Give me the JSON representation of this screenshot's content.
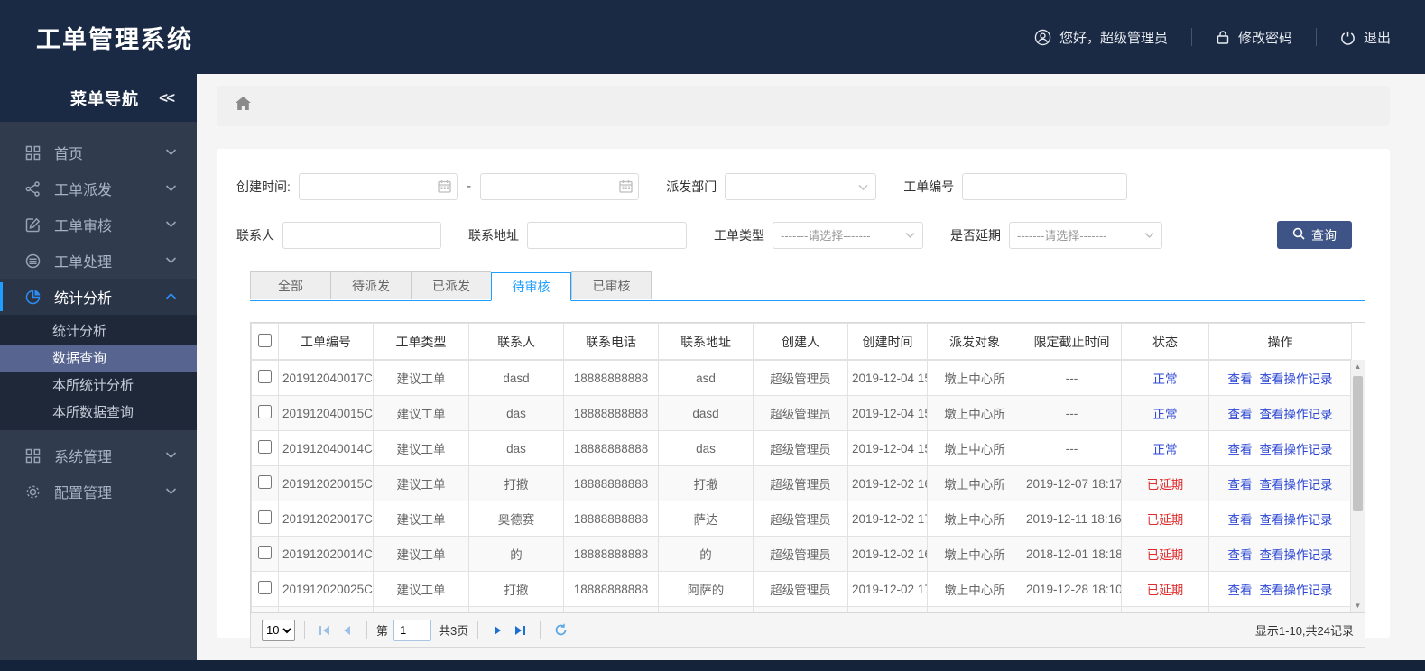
{
  "app": {
    "title": "工单管理系统"
  },
  "topbar": {
    "greeting": "您好，超级管理员",
    "change_password": "修改密码",
    "logout": "退出"
  },
  "sidebar": {
    "title": "菜单导航",
    "collapse_glyph": "<<",
    "items": [
      {
        "label": "首页"
      },
      {
        "label": "工单派发"
      },
      {
        "label": "工单审核"
      },
      {
        "label": "工单处理"
      },
      {
        "label": "统计分析"
      },
      {
        "label": "系统管理"
      },
      {
        "label": "配置管理"
      }
    ],
    "submenu": [
      {
        "label": "统计分析"
      },
      {
        "label": "数据查询"
      },
      {
        "label": "本所统计分析"
      },
      {
        "label": "本所数据查询"
      }
    ]
  },
  "filters": {
    "create_time_label": "创建时间:",
    "date_separator": "-",
    "depart_label": "派发部门",
    "order_no_label": "工单编号",
    "contact_label": "联系人",
    "address_label": "联系地址",
    "order_type_label": "工单类型",
    "order_type_value": "-------请选择-------",
    "delay_label": "是否延期",
    "delay_value": "-------请选择-------",
    "search_button": "查询"
  },
  "tabs": [
    {
      "label": "全部"
    },
    {
      "label": "待派发"
    },
    {
      "label": "已派发"
    },
    {
      "label": "待审核"
    },
    {
      "label": "已审核"
    }
  ],
  "table": {
    "columns": [
      "工单编号",
      "工单类型",
      "联系人",
      "联系电话",
      "联系地址",
      "创建人",
      "创建时间",
      "派发对象",
      "限定截止时间",
      "状态",
      "操作"
    ],
    "action_view": "查看",
    "action_log": "查看操作记录",
    "rows": [
      {
        "order_no": "201912040017C",
        "type": "建议工单",
        "contact": "dasd",
        "phone": "18888888888",
        "address": "asd",
        "creator": "超级管理员",
        "created": "2019-12-04 15",
        "target": "墩上中心所",
        "deadline": "---",
        "status": "正常",
        "delayed": false
      },
      {
        "order_no": "201912040015C",
        "type": "建议工单",
        "contact": "das",
        "phone": "18888888888",
        "address": "dasd",
        "creator": "超级管理员",
        "created": "2019-12-04 15",
        "target": "墩上中心所",
        "deadline": "---",
        "status": "正常",
        "delayed": false
      },
      {
        "order_no": "201912040014C",
        "type": "建议工单",
        "contact": "das",
        "phone": "18888888888",
        "address": "das",
        "creator": "超级管理员",
        "created": "2019-12-04 15",
        "target": "墩上中心所",
        "deadline": "---",
        "status": "正常",
        "delayed": false
      },
      {
        "order_no": "201912020015C",
        "type": "建议工单",
        "contact": "打撤",
        "phone": "18888888888",
        "address": "打撤",
        "creator": "超级管理员",
        "created": "2019-12-02 16",
        "target": "墩上中心所",
        "deadline": "2019-12-07 18:17",
        "status": "已延期",
        "delayed": true
      },
      {
        "order_no": "201912020017C",
        "type": "建议工单",
        "contact": "奥德赛",
        "phone": "18888888888",
        "address": "萨达",
        "creator": "超级管理员",
        "created": "2019-12-02 17",
        "target": "墩上中心所",
        "deadline": "2019-12-11 18:16",
        "status": "已延期",
        "delayed": true
      },
      {
        "order_no": "201912020014C",
        "type": "建议工单",
        "contact": "的",
        "phone": "18888888888",
        "address": "的",
        "creator": "超级管理员",
        "created": "2019-12-02 16",
        "target": "墩上中心所",
        "deadline": "2018-12-01 18:18",
        "status": "已延期",
        "delayed": true
      },
      {
        "order_no": "201912020025C",
        "type": "建议工单",
        "contact": "打撤",
        "phone": "18888888888",
        "address": "阿萨的",
        "creator": "超级管理员",
        "created": "2019-12-02 17",
        "target": "墩上中心所",
        "deadline": "2019-12-28 18:10",
        "status": "已延期",
        "delayed": true
      },
      {
        "order_no": "",
        "type": "",
        "contact": "",
        "phone": "",
        "address": "",
        "creator": "",
        "created": "",
        "target": "",
        "deadline": "",
        "status": "",
        "delayed": false,
        "partial": true
      }
    ]
  },
  "pagination": {
    "page_size": "10",
    "page_prefix": "第",
    "current_page": "1",
    "total_pages": "共3页",
    "summary": "显示1-10,共24记录"
  },
  "colors": {
    "header_navy": "#1B2A44",
    "sidebar_bg": "#303B4E",
    "submenu_bg": "#1E2839",
    "submenu_selected": "#57648F",
    "accent_blue": "#1E9FFF",
    "link_blue": "#2B46D4",
    "status_red": "#E02B2B",
    "search_button_bg": "#3E5486"
  }
}
